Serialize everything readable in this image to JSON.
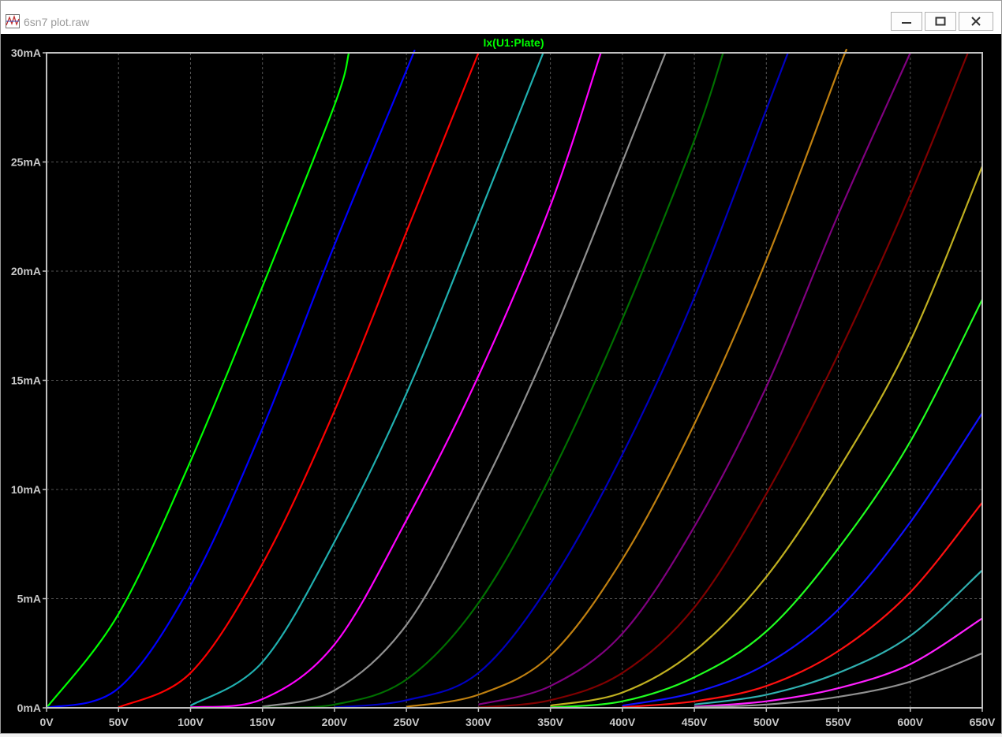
{
  "window": {
    "title": "6sn7 plot.raw",
    "buttons": [
      "minimize",
      "maximize",
      "close"
    ]
  },
  "colors": {
    "background": "#000000",
    "grid": "#555555",
    "axis": "#c0c0c0",
    "tick_label": "#c8c8c8",
    "trace_label": "#00ff00"
  },
  "chart_data": {
    "type": "line",
    "title": "Ix(U1:Plate)",
    "xlabel": "",
    "ylabel": "",
    "xlim": [
      0,
      650
    ],
    "ylim": [
      0,
      30
    ],
    "x_ticks": [
      "0V",
      "50V",
      "100V",
      "150V",
      "200V",
      "250V",
      "300V",
      "350V",
      "400V",
      "450V",
      "500V",
      "550V",
      "600V",
      "650V"
    ],
    "y_ticks": [
      "0mA",
      "5mA",
      "10mA",
      "15mA",
      "20mA",
      "25mA",
      "30mA"
    ],
    "grid": true,
    "legend": "none",
    "series": [
      {
        "color": "#00ff00",
        "x": [
          0,
          50,
          100,
          150,
          200,
          210
        ],
        "y": [
          0,
          4.3,
          11.3,
          19.3,
          27.6,
          30
        ]
      },
      {
        "color": "#0000ff",
        "x": [
          0,
          50,
          100,
          150,
          200,
          250,
          255
        ],
        "y": [
          0,
          0.9,
          5.6,
          12.8,
          21.2,
          29.2,
          30
        ]
      },
      {
        "color": "#ff0000",
        "x": [
          50,
          100,
          150,
          200,
          250,
          300
        ],
        "y": [
          0.02,
          1.6,
          6.6,
          13.6,
          21.8,
          30
        ]
      },
      {
        "color": "#20b0b0",
        "x": [
          100,
          150,
          200,
          250,
          300,
          345
        ],
        "y": [
          0.1,
          2.1,
          7.6,
          14.4,
          22.5,
          30
        ]
      },
      {
        "color": "#ff00ff",
        "x": [
          100,
          150,
          200,
          250,
          300,
          350,
          385
        ],
        "y": [
          0.02,
          0.4,
          2.9,
          8.6,
          15.2,
          23.0,
          30
        ]
      },
      {
        "color": "#909090",
        "x": [
          150,
          200,
          250,
          300,
          350,
          400,
          430
        ],
        "y": [
          0.05,
          0.8,
          3.8,
          9.7,
          16.8,
          25.0,
          30
        ]
      },
      {
        "color": "#007000",
        "x": [
          150,
          200,
          250,
          300,
          350,
          400,
          450,
          470
        ],
        "y": [
          0.01,
          0.15,
          1.3,
          4.8,
          10.6,
          17.8,
          26.0,
          30
        ]
      },
      {
        "color": "#0000c0",
        "x": [
          200,
          250,
          300,
          350,
          400,
          450,
          500,
          515
        ],
        "y": [
          0.02,
          0.35,
          1.6,
          5.7,
          11.6,
          18.8,
          27.4,
          30
        ]
      },
      {
        "color": "#c08010",
        "x": [
          250,
          300,
          350,
          400,
          450,
          500,
          550,
          555
        ],
        "y": [
          0.05,
          0.6,
          2.4,
          6.8,
          13.0,
          20.5,
          29.2,
          30
        ]
      },
      {
        "color": "#800080",
        "x": [
          300,
          350,
          400,
          450,
          500,
          550,
          600
        ],
        "y": [
          0.15,
          1.0,
          3.4,
          8.3,
          14.7,
          22.6,
          30
        ]
      },
      {
        "color": "#800000",
        "x": [
          300,
          350,
          400,
          450,
          500,
          550,
          600,
          640
        ],
        "y": [
          0.02,
          0.35,
          1.6,
          4.6,
          9.8,
          16.2,
          23.5,
          30
        ]
      },
      {
        "color": "#c0b020",
        "x": [
          350,
          400,
          450,
          500,
          550,
          600,
          650
        ],
        "y": [
          0.1,
          0.7,
          2.6,
          6.0,
          10.9,
          16.8,
          24.8
        ]
      },
      {
        "color": "#20ff20",
        "x": [
          350,
          400,
          450,
          500,
          550,
          600,
          650
        ],
        "y": [
          0.02,
          0.3,
          1.4,
          3.5,
          7.3,
          12.2,
          18.7
        ]
      },
      {
        "color": "#1010ff",
        "x": [
          400,
          450,
          500,
          550,
          600,
          650
        ],
        "y": [
          0.1,
          0.7,
          2.0,
          4.5,
          8.5,
          13.5
        ]
      },
      {
        "color": "#ff1010",
        "x": [
          400,
          450,
          500,
          550,
          600,
          650
        ],
        "y": [
          0.03,
          0.3,
          1.0,
          2.6,
          5.3,
          9.4
        ]
      },
      {
        "color": "#30b0b0",
        "x": [
          450,
          500,
          550,
          600,
          650
        ],
        "y": [
          0.15,
          0.6,
          1.6,
          3.3,
          6.3
        ]
      },
      {
        "color": "#ff20ff",
        "x": [
          450,
          500,
          550,
          600,
          650
        ],
        "y": [
          0.05,
          0.3,
          0.9,
          2.0,
          4.1
        ]
      },
      {
        "color": "#909090",
        "x": [
          450,
          500,
          550,
          600,
          650
        ],
        "y": [
          0.02,
          0.15,
          0.5,
          1.2,
          2.5
        ]
      }
    ]
  }
}
